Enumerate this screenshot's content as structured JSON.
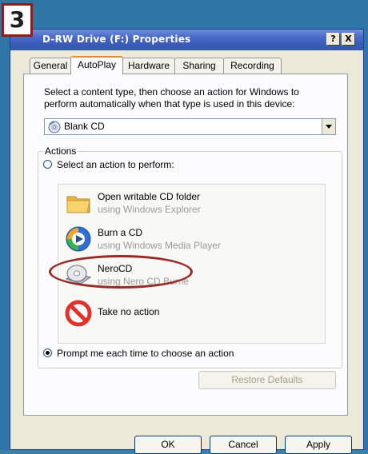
{
  "step_number": "3",
  "window": {
    "title": "D-RW Drive (F:) Properties",
    "help_button": "?",
    "close_button": "X"
  },
  "tabs": [
    {
      "label": "General",
      "active": false
    },
    {
      "label": "AutoPlay",
      "active": true
    },
    {
      "label": "Hardware",
      "active": false
    },
    {
      "label": "Sharing",
      "active": false
    },
    {
      "label": "Recording",
      "active": false
    }
  ],
  "instruction": "Select a content type, then choose an action for Windows to perform automatically when that type is used in this device:",
  "content_type": {
    "selected": "Blank CD",
    "icon": "cd-icon"
  },
  "actions_group": {
    "label": "Actions",
    "select_option": "Select an action to perform:",
    "prompt_option": "Prompt me each time to choose an action",
    "selected_option": "prompt",
    "items": [
      {
        "name": "Open writable CD folder",
        "sub": "using Windows Explorer",
        "icon": "folder-icon"
      },
      {
        "name": "Burn a CD",
        "sub": "using Windows Media Player",
        "icon": "media-player-icon"
      },
      {
        "name": "NeroCD",
        "sub": "using Nero CD Burne",
        "icon": "nero-cd-icon",
        "highlighted": true
      },
      {
        "name": "Take no action",
        "sub": "",
        "icon": "no-action-icon"
      }
    ]
  },
  "buttons": {
    "restore": "Restore Defaults",
    "ok": "OK",
    "cancel": "Cancel",
    "apply": "Apply"
  },
  "colors": {
    "titlebar": "#3a5bb8",
    "highlight_oval": "#9a2a25",
    "step_badge_border": "#8b1e1e",
    "active_tab_accent": "#e68b2c"
  }
}
